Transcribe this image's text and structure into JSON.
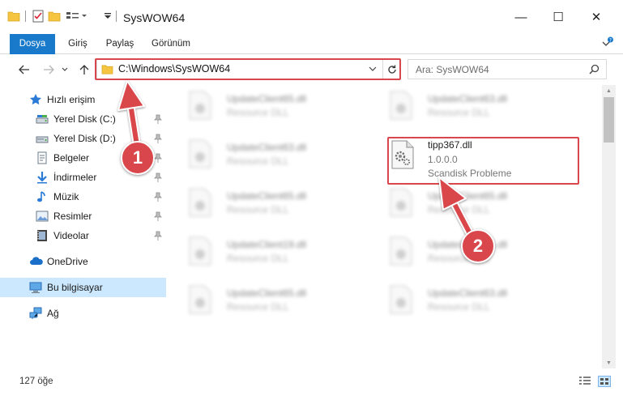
{
  "window": {
    "title": "SysWOW64",
    "minimize_glyph": "—",
    "maximize_glyph": "☐",
    "close_glyph": "✕"
  },
  "ribbon": {
    "tabs": [
      {
        "label": "Dosya",
        "active": true
      },
      {
        "label": "Giriş"
      },
      {
        "label": "Paylaş"
      },
      {
        "label": "Görünüm"
      }
    ]
  },
  "address": {
    "path": "C:\\Windows\\SysWOW64",
    "search_placeholder": "Ara: SysWOW64"
  },
  "nav": {
    "quick_access": "Hızlı erişim",
    "items": [
      {
        "label": "Yerel Disk (C:)",
        "icon": "drive-icon",
        "pinned": true
      },
      {
        "label": "Yerel Disk (D:)",
        "icon": "drive-icon",
        "pinned": true
      },
      {
        "label": "Belgeler",
        "icon": "documents-icon",
        "pinned": true
      },
      {
        "label": "İndirmeler",
        "icon": "downloads-icon",
        "pinned": true
      },
      {
        "label": "Müzik",
        "icon": "music-icon",
        "pinned": true
      },
      {
        "label": "Resimler",
        "icon": "pictures-icon",
        "pinned": true
      },
      {
        "label": "Videolar",
        "icon": "videos-icon",
        "pinned": true
      }
    ],
    "onedrive": "OneDrive",
    "this_pc": "Bu bilgisayar",
    "network": "Ağ"
  },
  "files": [
    {
      "name": "UpdateClient65.dll",
      "desc": "Resource DLL"
    },
    {
      "name": "UpdateClient63.dll",
      "desc": "Resource DLL"
    },
    {
      "name": "UpdateClient63.dll",
      "desc": "Resource DLL"
    },
    {
      "name": "tipp367.dll",
      "desc": "1.0.0.0",
      "desc2": "Scandisk Probleme",
      "highlighted": true
    },
    {
      "name": "UpdateClient65.dll",
      "desc": "Resource DLL"
    },
    {
      "name": "UpdateClient65.dll",
      "desc": "Resource DLL"
    },
    {
      "name": "UpdateClient19.dll",
      "desc": "Resource DLL"
    },
    {
      "name": "UpdateClient65.dll",
      "desc": "Resource DLL"
    },
    {
      "name": "UpdateClient65.dll",
      "desc": "Resource DLL"
    },
    {
      "name": "UpdateClient63.dll",
      "desc": "Resource DLL"
    }
  ],
  "status": {
    "count": "127 öğe"
  },
  "annotations": {
    "step1": "1",
    "step2": "2",
    "color": "#d9464b"
  },
  "colors": {
    "accent": "#1979ca",
    "selection": "#cce8ff"
  }
}
